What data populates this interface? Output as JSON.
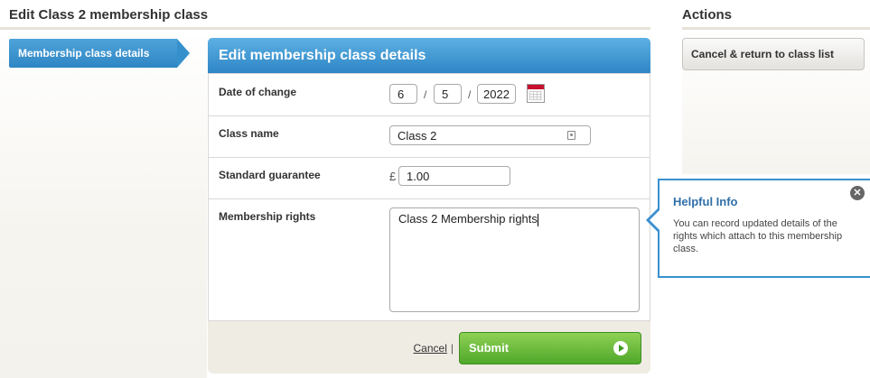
{
  "page": {
    "title": "Edit Class 2 membership class"
  },
  "sidebar": {
    "items": [
      {
        "label": "Membership class details",
        "active": true
      }
    ]
  },
  "form": {
    "heading": "Edit membership class details",
    "date": {
      "label": "Date of change",
      "day": "6",
      "month": "5",
      "year": "2022",
      "separator": "/",
      "icon": "calendar-icon"
    },
    "class_name": {
      "label": "Class name",
      "value": "Class 2",
      "icon": "contact-card-icon"
    },
    "guarantee": {
      "label": "Standard guarantee",
      "currency": "£",
      "value": "1.00"
    },
    "rights": {
      "label": "Membership rights",
      "value": "Class 2 Membership rights"
    },
    "cancel_label": "Cancel",
    "cancel_separator": "|",
    "submit_label": "Submit",
    "submit_icon": "arrow-right-icon"
  },
  "actions": {
    "title": "Actions",
    "cancel_button": "Cancel & return to class list"
  },
  "help": {
    "title": "Helpful Info",
    "text": "You can record updated details of the rights which attach to this membership class.",
    "close_icon": "close-icon"
  },
  "colors": {
    "accent_blue": "#2f86c5",
    "submit_green": "#4fa82a",
    "help_border": "#3a8fcf"
  }
}
